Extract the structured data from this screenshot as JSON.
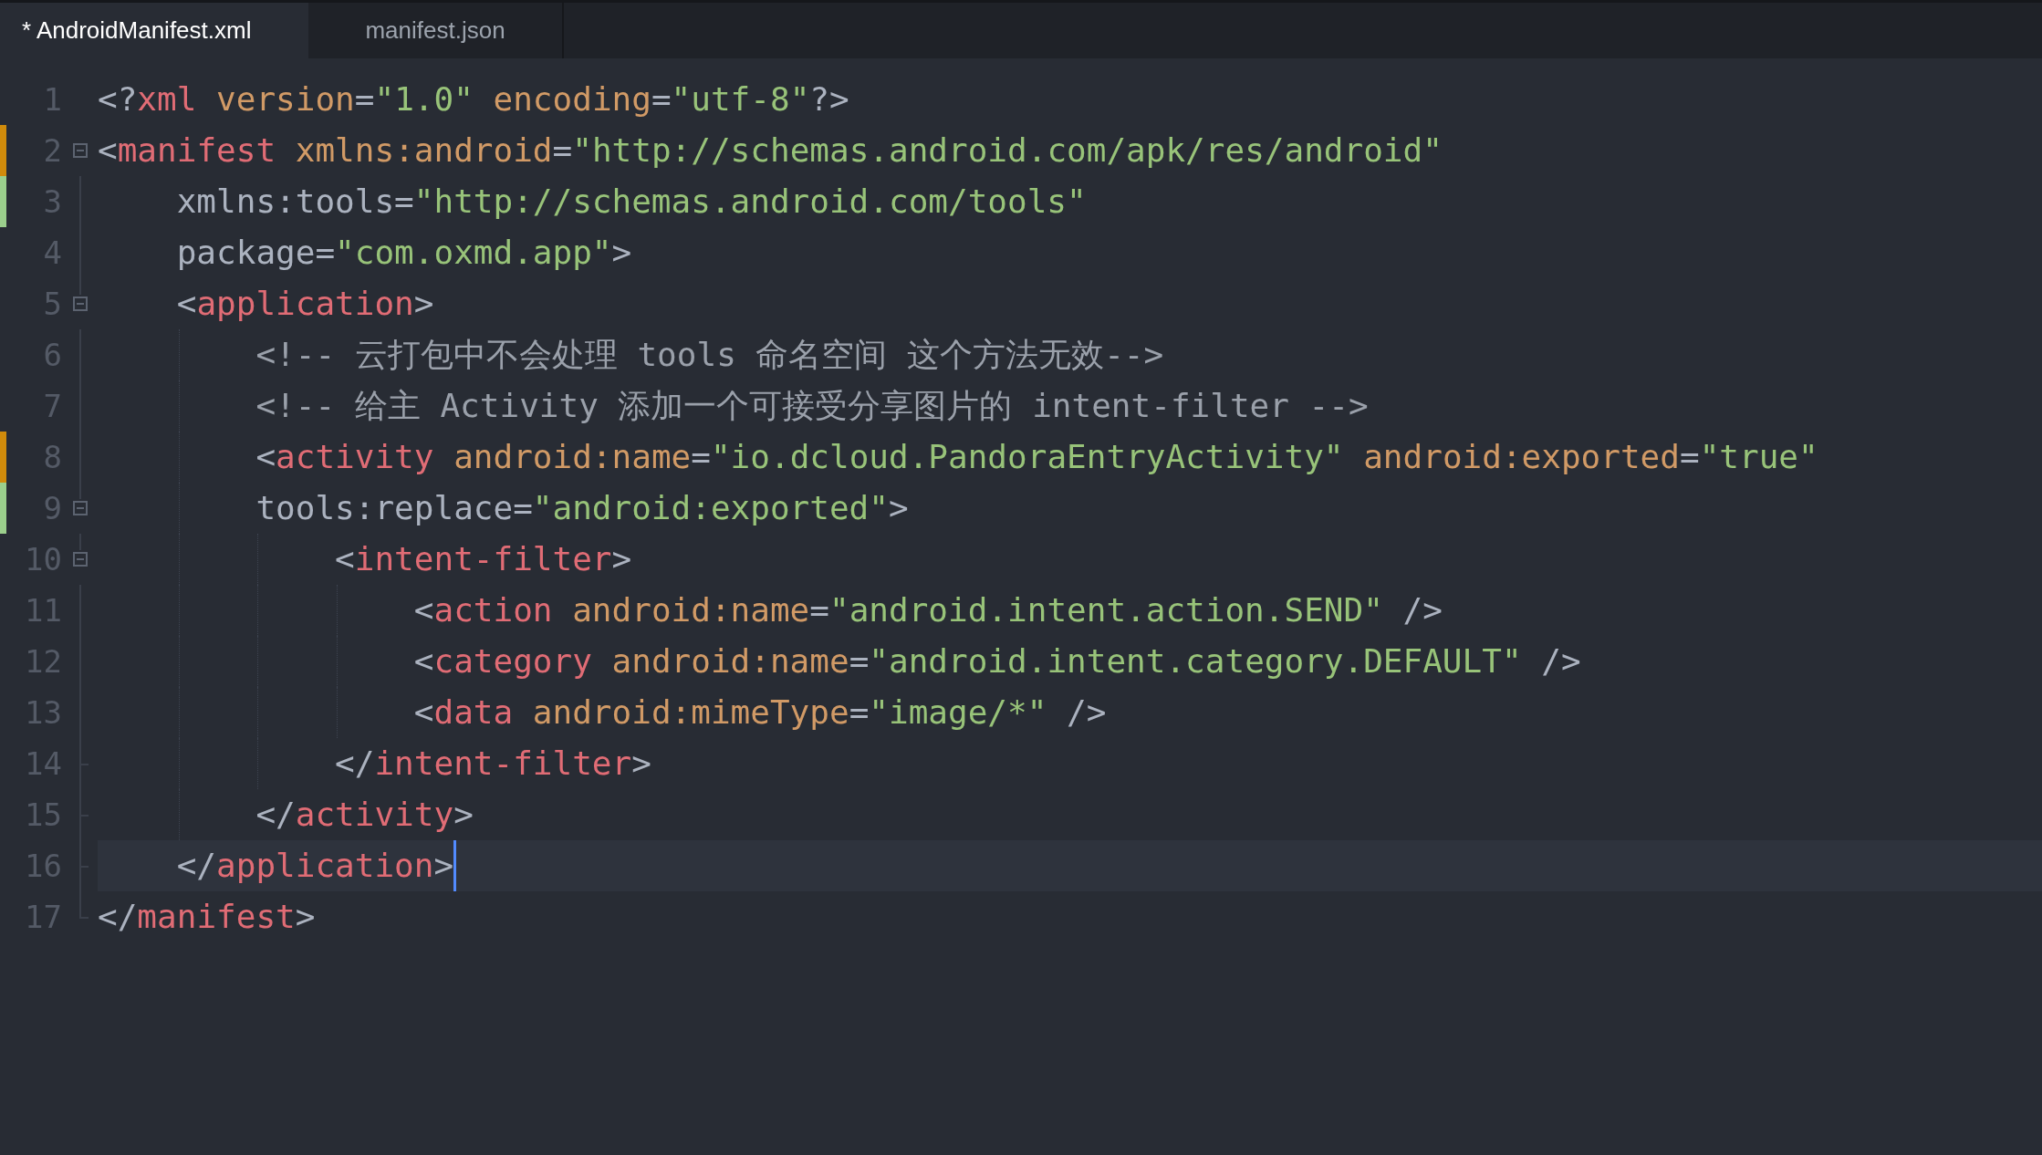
{
  "tabs": [
    {
      "label": "* AndroidManifest.xml",
      "selected": true
    },
    {
      "label": "manifest.json",
      "selected": false
    }
  ],
  "lines": [
    {
      "number": "1",
      "kind": "plain",
      "current": false,
      "tokens": [
        {
          "kind": "punct",
          "text": "<?"
        },
        {
          "kind": "tag",
          "text": "xml "
        },
        {
          "kind": "attr",
          "text": "version"
        },
        {
          "kind": "punct",
          "text": "="
        },
        {
          "kind": "string",
          "text": "\"1.0\" "
        },
        {
          "kind": "attr",
          "text": "encoding"
        },
        {
          "kind": "punct",
          "text": "="
        },
        {
          "kind": "string",
          "text": "\"utf-8\""
        },
        {
          "kind": "punct",
          "text": "?>"
        }
      ]
    },
    {
      "number": "2",
      "kind": "opener",
      "color": "#d08b0b",
      "current": false,
      "tokens": [
        {
          "kind": "punct",
          "text": "<"
        },
        {
          "kind": "tag",
          "text": "manifest "
        },
        {
          "kind": "attr",
          "text": "xmlns:android"
        },
        {
          "kind": "punct",
          "text": "="
        },
        {
          "kind": "string",
          "text": "\"http://schemas.android.com/apk/res/android\""
        }
      ]
    },
    {
      "number": "3",
      "kind": "plain",
      "color": "#9bcf8c",
      "current": false,
      "tokens": [
        {
          "kind": "punct",
          "text": "    xmlns:tools="
        },
        {
          "kind": "string",
          "text": "\"http://schemas.android.com/tools\""
        }
      ]
    },
    {
      "number": "4",
      "kind": "plain",
      "current": false,
      "tokens": [
        {
          "kind": "punct",
          "text": "    package="
        },
        {
          "kind": "string",
          "text": "\"com.oxmd.app\""
        },
        {
          "kind": "punct",
          "text": ">"
        }
      ]
    },
    {
      "number": "5",
      "kind": "opener",
      "current": false,
      "tokens": [
        {
          "kind": "punct",
          "text": "    <"
        },
        {
          "kind": "tag",
          "text": "application"
        },
        {
          "kind": "punct",
          "text": ">"
        }
      ]
    },
    {
      "number": "6",
      "kind": "plain",
      "current": false,
      "tokens": [
        {
          "kind": "comment",
          "text": "        <!-- 云打包中不会处理 tools 命名空间 这个方法无效-->"
        }
      ]
    },
    {
      "number": "7",
      "kind": "plain",
      "current": false,
      "tokens": [
        {
          "kind": "comment",
          "text": "        <!-- 给主 Activity 添加一个可接受分享图片的 intent-filter -->"
        }
      ]
    },
    {
      "number": "8",
      "kind": "plain",
      "color": "#d08b0b",
      "current": false,
      "tokens": [
        {
          "kind": "punct",
          "text": "        <"
        },
        {
          "kind": "tag",
          "text": "activity "
        },
        {
          "kind": "attr",
          "text": "android:name"
        },
        {
          "kind": "punct",
          "text": "="
        },
        {
          "kind": "string",
          "text": "\"io.dcloud.PandoraEntryActivity\" "
        },
        {
          "kind": "attr",
          "text": "android:exported"
        },
        {
          "kind": "punct",
          "text": "="
        },
        {
          "kind": "string",
          "text": "\"true\""
        }
      ]
    },
    {
      "number": "9",
      "kind": "opener",
      "color": "#9bcf8c",
      "current": false,
      "tokens": [
        {
          "kind": "punct",
          "text": "        tools:replace="
        },
        {
          "kind": "string",
          "text": "\"android:exported\""
        },
        {
          "kind": "punct",
          "text": ">"
        }
      ]
    },
    {
      "number": "10",
      "kind": "opener",
      "current": false,
      "tokens": [
        {
          "kind": "punct",
          "text": "            <"
        },
        {
          "kind": "tag",
          "text": "intent-filter"
        },
        {
          "kind": "punct",
          "text": ">"
        }
      ]
    },
    {
      "number": "11",
      "kind": "plain",
      "current": false,
      "tokens": [
        {
          "kind": "punct",
          "text": "                <"
        },
        {
          "kind": "tag",
          "text": "action "
        },
        {
          "kind": "attr",
          "text": "android:name"
        },
        {
          "kind": "punct",
          "text": "="
        },
        {
          "kind": "string",
          "text": "\"android.intent.action.SEND\""
        },
        {
          "kind": "punct",
          "text": " />"
        }
      ]
    },
    {
      "number": "12",
      "kind": "plain",
      "current": false,
      "tokens": [
        {
          "kind": "punct",
          "text": "                <"
        },
        {
          "kind": "tag",
          "text": "category "
        },
        {
          "kind": "attr",
          "text": "android:name"
        },
        {
          "kind": "punct",
          "text": "="
        },
        {
          "kind": "string",
          "text": "\"android.intent.category.DEFAULT\""
        },
        {
          "kind": "punct",
          "text": " />"
        }
      ]
    },
    {
      "number": "13",
      "kind": "plain",
      "current": false,
      "tokens": [
        {
          "kind": "punct",
          "text": "                <"
        },
        {
          "kind": "tag",
          "text": "data "
        },
        {
          "kind": "attr",
          "text": "android:mimeType"
        },
        {
          "kind": "punct",
          "text": "="
        },
        {
          "kind": "string",
          "text": "\"image/*\""
        },
        {
          "kind": "punct",
          "text": " />"
        }
      ]
    },
    {
      "number": "14",
      "kind": "closer",
      "current": false,
      "tokens": [
        {
          "kind": "punct",
          "text": "            </"
        },
        {
          "kind": "tag",
          "text": "intent-filter"
        },
        {
          "kind": "punct",
          "text": ">"
        }
      ]
    },
    {
      "number": "15",
      "kind": "closer",
      "current": false,
      "tokens": [
        {
          "kind": "punct",
          "text": "        </"
        },
        {
          "kind": "tag",
          "text": "activity"
        },
        {
          "kind": "punct",
          "text": ">"
        }
      ]
    },
    {
      "number": "16",
      "kind": "closer",
      "current": true,
      "tokens": [
        {
          "kind": "punct",
          "text": "    </"
        },
        {
          "kind": "tag",
          "text": "application"
        },
        {
          "kind": "punct",
          "text": ">"
        }
      ]
    },
    {
      "number": "17",
      "kind": "closer",
      "current": false,
      "tokens": [
        {
          "kind": "punct",
          "text": "</"
        },
        {
          "kind": "tag",
          "text": "manifest"
        },
        {
          "kind": "punct",
          "text": ">"
        }
      ]
    }
  ]
}
